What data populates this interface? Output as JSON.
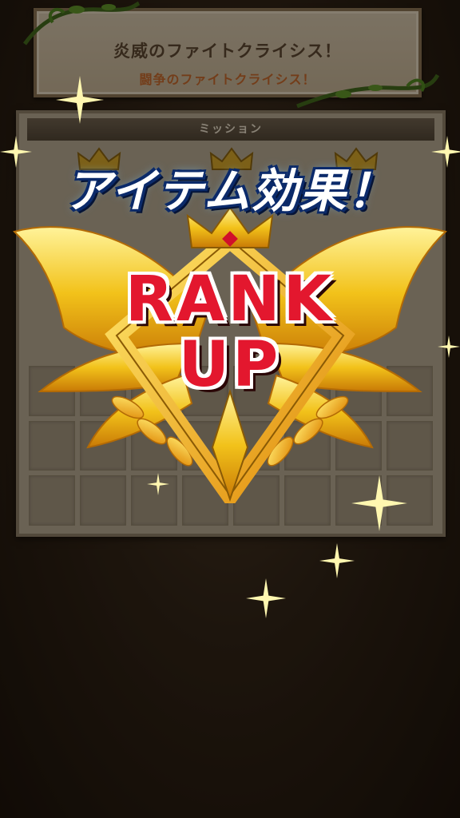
{
  "board": {
    "title": "炎威のファイトクライシス！",
    "subtitle": "闘争のファイトクライシス！"
  },
  "panel": {
    "header": "ミッション",
    "crowns": 3,
    "grid_cells": 24
  },
  "overlay": {
    "banner": "アイテム効果！",
    "rank_line1": "RANK",
    "rank_line2": "UP"
  },
  "colors": {
    "gold": "#f2c21a",
    "rank_red": "#e3172e",
    "banner_blue": "#0b2a6a"
  },
  "icons": [
    "vine-icon",
    "crown-icon",
    "winged-emblem-icon",
    "sparkle-icon"
  ]
}
